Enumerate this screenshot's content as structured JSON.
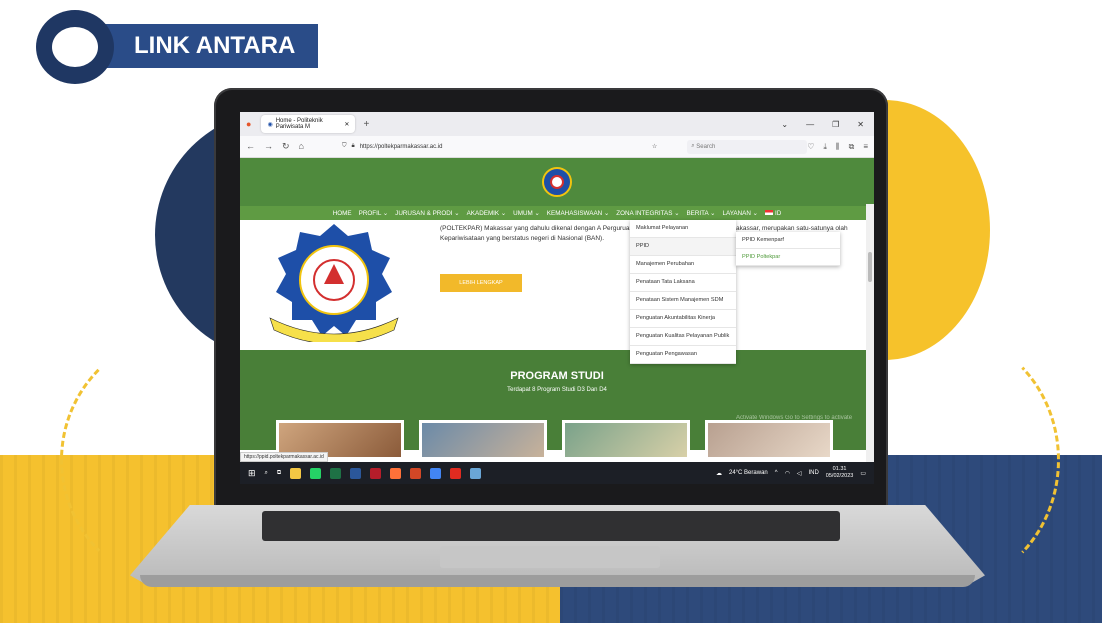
{
  "badge": {
    "label": "LINK ANTARA"
  },
  "browser": {
    "tab_title": "Home - Politeknik Pariwisata M",
    "url": "https://poltekparmakassar.ac.id",
    "search_placeholder": "Search",
    "status_url": "https://ppid.poltekparmakassar.ac.id"
  },
  "site": {
    "nav": [
      "HOME",
      "PROFIL",
      "JURUSAN & PRODI",
      "AKADEMIK",
      "UMUM",
      "KEMAHASISWAAN",
      "ZONA INTEGRITAS",
      "BERITA",
      "LAYANAN",
      "ID"
    ],
    "about_left": "(POLTEKPAR) Makassar yang dahulu dikenal dengan A Perguruan Tinggi Kepariwisataan yang berstatus negeri di Nasional (BAN).",
    "about_right": "akassar, merupakan satu-satunya olah terakreditasi Badan Akreditasi",
    "more_button": "LEBIH LENGKAP",
    "logo_text_top": "POLITEKNIK PARIWISATA",
    "logo_text_mid": "MAKASSAR",
    "logo_text_banner": "KUALLEANGANGI TALLANGA NA TOALIA",
    "prodi_title": "PROGRAM STUDI",
    "prodi_subtitle": "Terdapat 8 Program Studi D3 Dan D4",
    "watermark": "Activate Windows Go to Settings to activate Windows."
  },
  "dropdown": {
    "items": [
      "Maklumat Pelayanan",
      "PPID",
      "Manajemen Perubahan",
      "Penataan Tata Laksana",
      "Penataan Sistem Manajemen SDM",
      "Penguatan Akuntabilitas Kinerja",
      "Penguatan Kualitas Pelayanan Publik",
      "Penguatan Pengawasan"
    ]
  },
  "subdropdown": {
    "items": [
      "PPID Kemenparf",
      "PPID Poltekpar"
    ]
  },
  "taskbar": {
    "weather": "24°C Berawan",
    "lang": "IND",
    "time": "01.31",
    "date": "05/02/2023"
  },
  "colors": {
    "green": "#4f8a3d",
    "navy": "#2a4c88",
    "yellow": "#f5c12e"
  }
}
